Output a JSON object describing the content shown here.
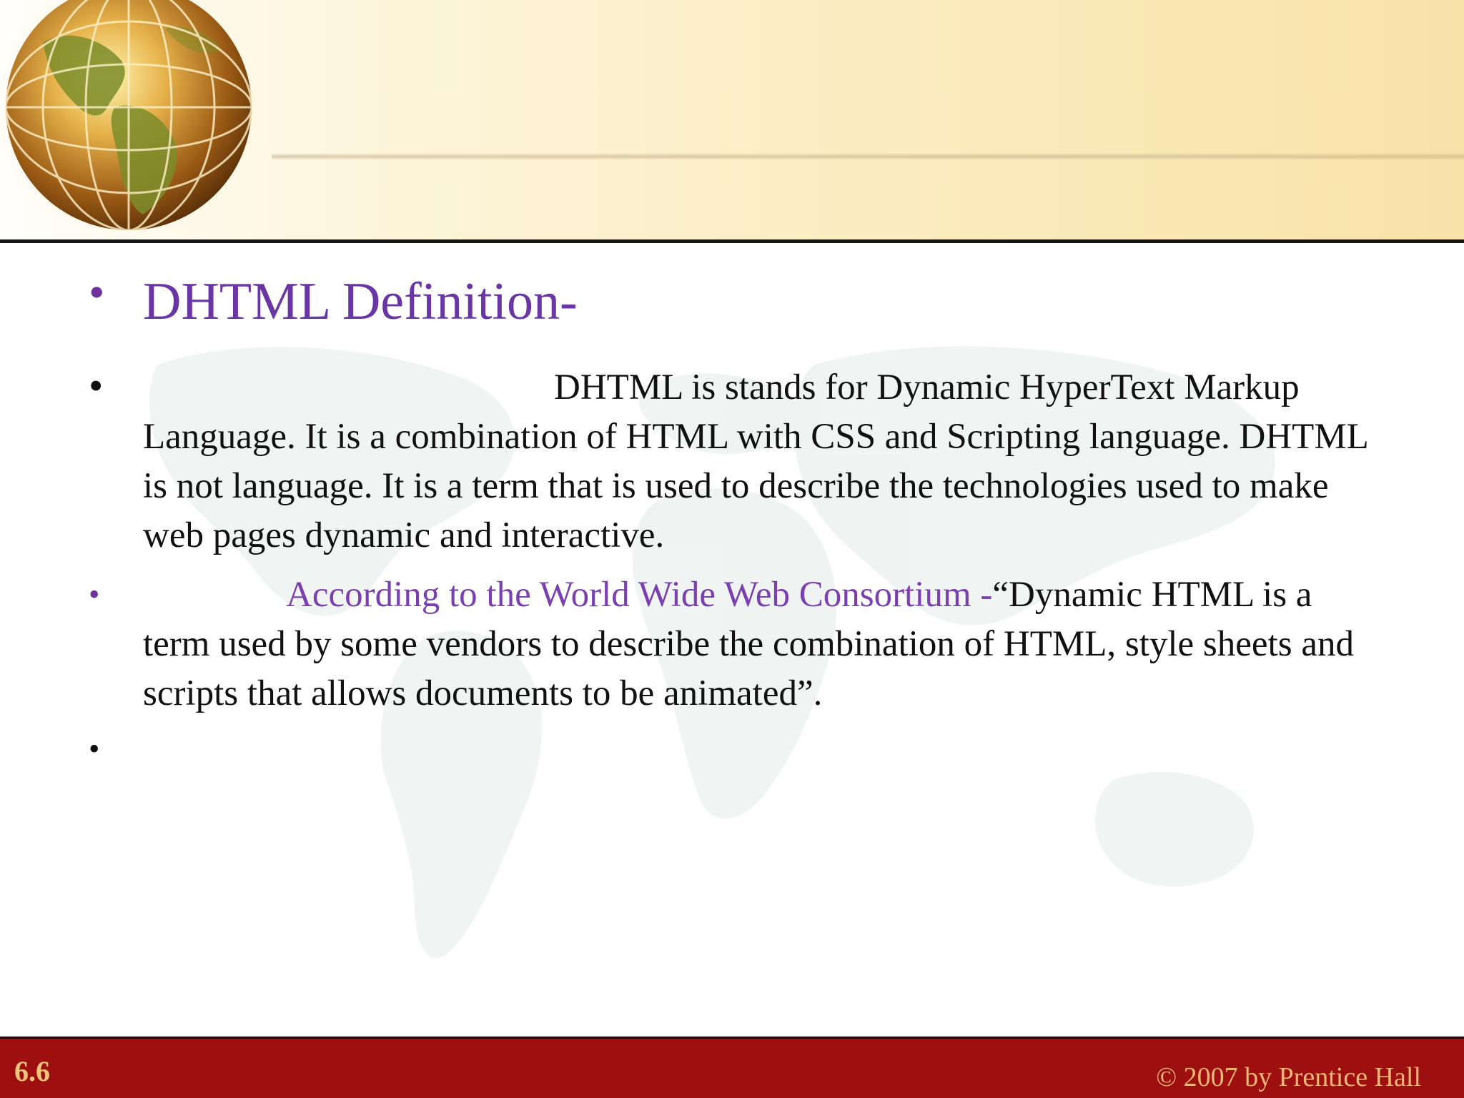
{
  "slide": {
    "title": "DHTML Definition-",
    "paragraph1": "DHTML is stands for Dynamic HyperText Markup Language. It is a combination of HTML with CSS and Scripting language. DHTML is not language. It is a term that is used to describe the technologies used to make web pages dynamic and interactive.",
    "paragraph2_highlight": "According to the World Wide Web Consortium -",
    "paragraph2_quote": "“Dynamic HTML is a term used by some vendors to describe the combination of HTML, style sheets and scripts that allows documents to be animated”.",
    "bullet_symbol": "•"
  },
  "footer": {
    "slide_number": "6.6",
    "copyright": "© 2007 by Prentice Hall"
  },
  "colors": {
    "title": "#6a35a4",
    "footer_bg": "#9e1010",
    "footer_text": "#f0b878"
  }
}
